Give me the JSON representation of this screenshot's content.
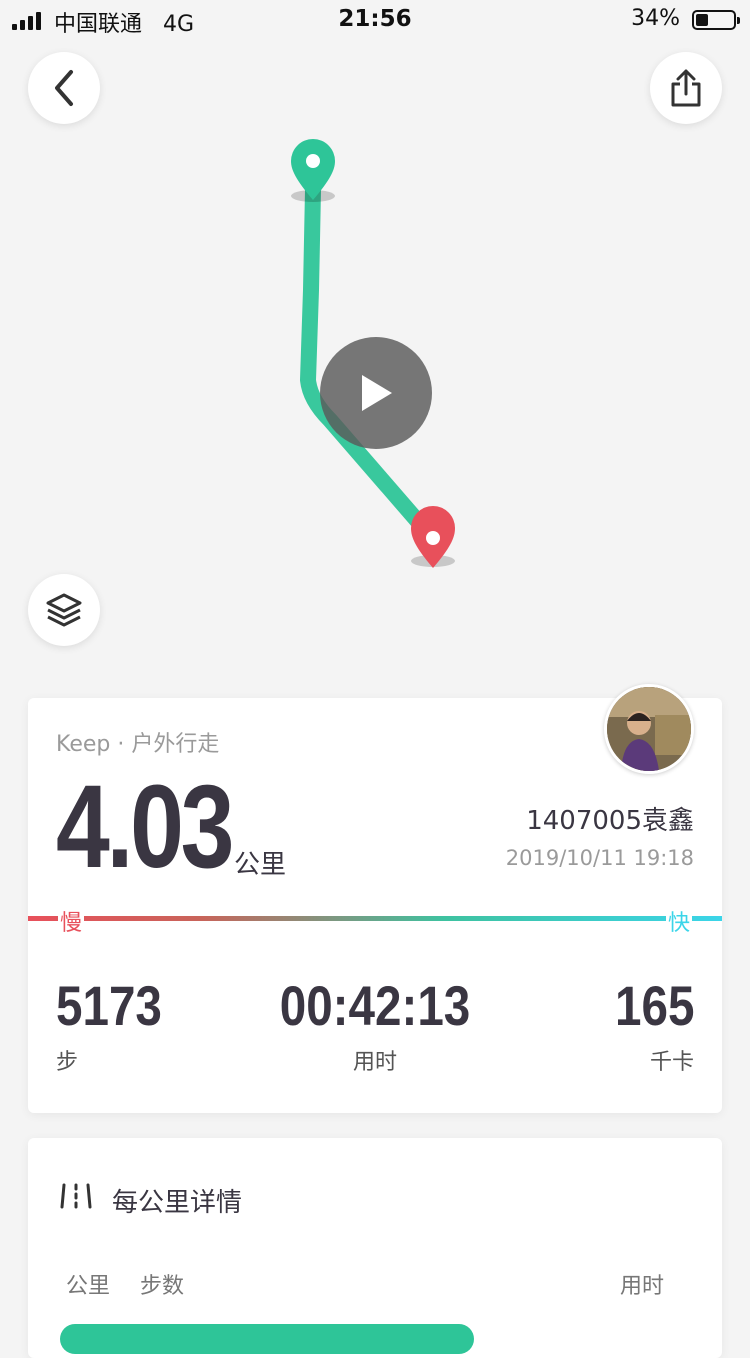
{
  "status_bar": {
    "carrier": "中国联通",
    "network": "4G",
    "time": "21:56",
    "battery_percent": "34%",
    "battery_level": 0.34
  },
  "map": {
    "back_icon": "chevron-left-icon",
    "share_icon": "share-icon",
    "layers_icon": "layers-icon",
    "play_icon": "play-icon",
    "start_marker_color": "#2ec598",
    "end_marker_color": "#e8505b",
    "route_color": "#2ec598"
  },
  "summary": {
    "activity_type": "Keep · 户外行走",
    "distance": "4.03",
    "distance_unit": "公里",
    "username": "1407005袁鑫",
    "datetime": "2019/10/11 19:18",
    "slow_label": "慢",
    "fast_label": "快",
    "stats": [
      {
        "value": "5173",
        "label": "步"
      },
      {
        "value": "00:42:13",
        "label": "用时"
      },
      {
        "value": "165",
        "label": "千卡"
      }
    ]
  },
  "detail": {
    "title": "每公里详情",
    "columns": {
      "km": "公里",
      "steps": "步数",
      "time": "用时"
    }
  },
  "colors": {
    "accent_green": "#2ec598",
    "accent_red": "#e8505b",
    "accent_cyan": "#3bd5e9",
    "text_dark": "#3a3642"
  }
}
